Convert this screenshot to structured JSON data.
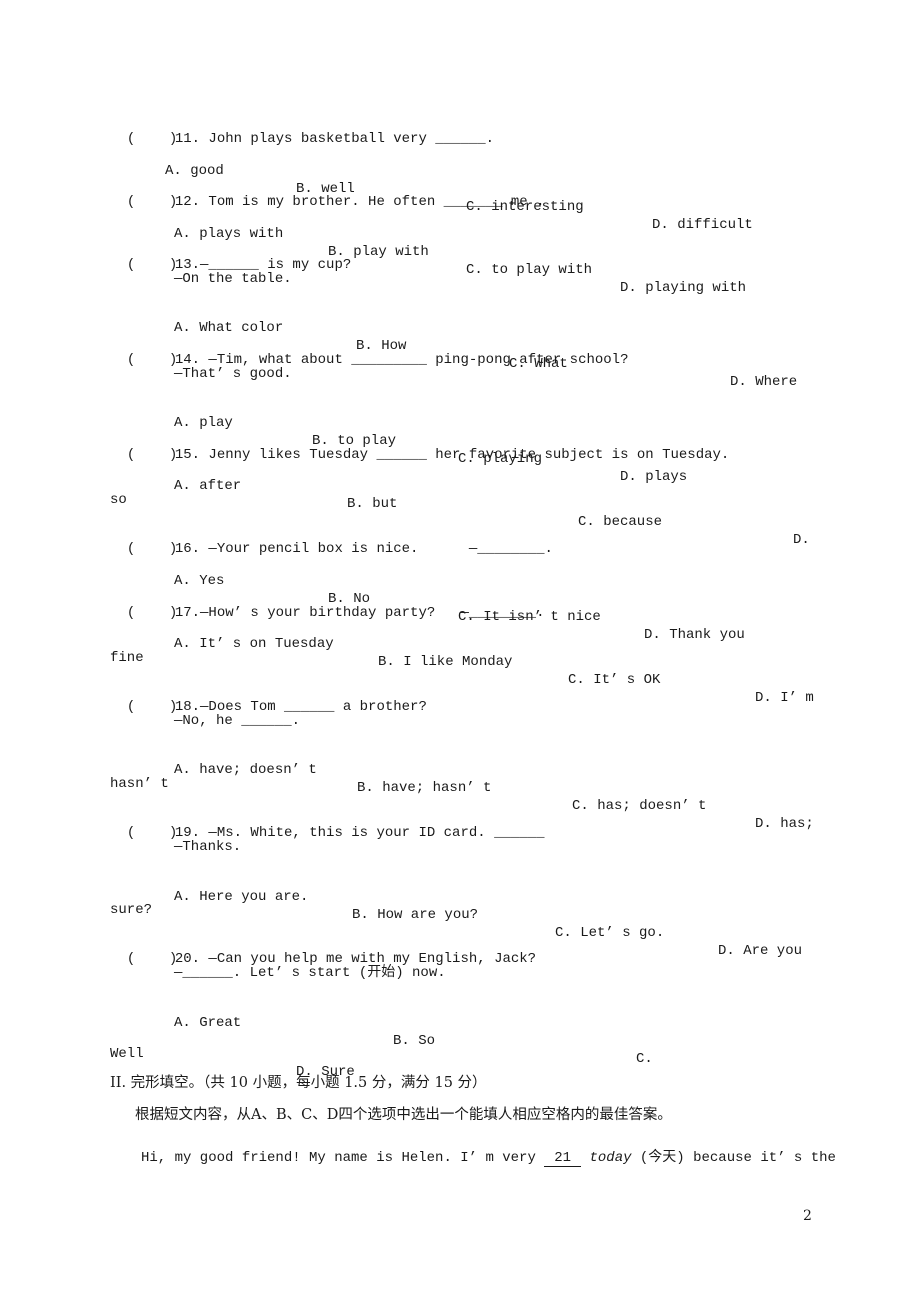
{
  "questions": [
    {
      "number": "11",
      "paren": "(    )",
      "stem": "11. John plays basketball very ______.",
      "options": {
        "A": "A. good",
        "B": "B. well",
        "C": "C. interesting",
        "D": "D. difficult"
      }
    },
    {
      "number": "12",
      "paren": "(    )",
      "stem": "12. Tom is my brother. He often _______ me .",
      "options": {
        "A": "A. plays with",
        "B": "B. play with",
        "C": "C. to play with",
        "D": "D. playing with"
      }
    },
    {
      "number": "13",
      "paren": "(    )",
      "stem": "13.—______ is my cup?",
      "reply": "—On the table.",
      "options": {
        "A": "A. What color",
        "B": "B. How",
        "C": "C. What",
        "D": "D. Where"
      }
    },
    {
      "number": "14",
      "paren": "(    )",
      "stem": "14. —Tim, what about _________ ping-pong after school?",
      "reply": "—That’ s good.",
      "options": {
        "A": "A. play",
        "B": "B. to play",
        "C": "C. playing",
        "D": "D. plays"
      }
    },
    {
      "number": "15",
      "paren": "(    )",
      "stem": "15. Jenny likes Tuesday ______ her favorite subject is on Tuesday.",
      "options": {
        "A": "A. after",
        "B": "B. but",
        "C": "C. because",
        "D": "D.",
        "D_wrap": "so"
      }
    },
    {
      "number": "16",
      "paren": "(    )",
      "stem": "16. —Your pencil box is nice.      —________.",
      "options": {
        "A": "A. Yes",
        "B": "B. No",
        "C": "C. It isn’ t nice",
        "D": "D. Thank you"
      }
    },
    {
      "number": "17",
      "paren": "(    )",
      "stem": "17.—How’ s your birthday party?   —________.",
      "options": {
        "A": "A. It’ s on Tuesday",
        "B": "B. I like Monday",
        "C": "C. It’ s OK",
        "D": "D. I’ m",
        "D_wrap": "fine"
      }
    },
    {
      "number": "18",
      "paren": "(    )",
      "stem": "18.—Does Tom ______ a brother?",
      "reply": "—No, he ______.",
      "options": {
        "A": "A. have; doesn’ t",
        "B": "B. have; hasn’ t",
        "C": "C. has; doesn’ t",
        "D": "D. has;",
        "D_wrap": "hasn’ t"
      }
    },
    {
      "number": "19",
      "paren": "(    )",
      "stem": "19. —Ms. White, this is your ID card. ______",
      "reply": "—Thanks.",
      "options": {
        "A": "A. Here you are.",
        "B": "B. How are you?",
        "C": "C. Let’ s go.",
        "D": "D. Are you",
        "D_wrap": "sure?"
      }
    },
    {
      "number": "20",
      "paren": "(    )",
      "stem": "20. —Can you help me with my English, Jack?",
      "reply": "—______. Let’ s start (开始) now.",
      "options": {
        "A": "A. Great",
        "B": "B. So",
        "C": "C.",
        "C_wrap": "Well",
        "D": "D. Sure"
      }
    }
  ],
  "section2": {
    "title": "II. 完形填空。（共 10 小题，每小题 1.5 分，满分 15 分）",
    "instruction": "根据短文内容，从A、B、C、D四个选项中选出一个能填人相应空格内的最佳答案。",
    "passage_start": "Hi, my good friend! My name is Helen. I’ m very ",
    "blank_number": "21",
    "italic_word": "today",
    "passage_rest": " (今天) because it’ s the"
  },
  "page_number": "2"
}
